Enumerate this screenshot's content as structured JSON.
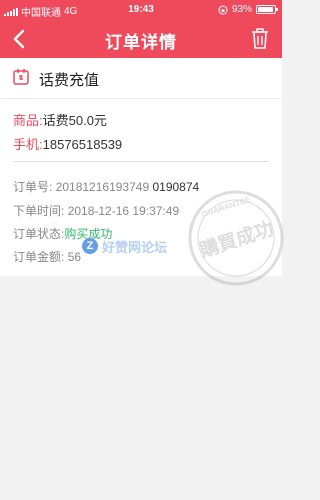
{
  "status": {
    "carrier": "中国联通",
    "network": "4G",
    "time": "19:43",
    "battery": "93%"
  },
  "nav": {
    "title": "订单详情",
    "icons": [
      "back-chevron-icon",
      "trash-icon"
    ]
  },
  "product": {
    "title": "话费充值",
    "icon": "phone-recharge-icon"
  },
  "info": {
    "goods_label": "商品:",
    "goods_value": "话费50.0元",
    "phone_label": "手机:",
    "phone_value": "18576518539"
  },
  "order": {
    "no_label": "订单号:",
    "no_value_a": "20181216193749",
    "no_value_b": "0190874",
    "time_label": "下单时间:",
    "time_value": "2018-12-16 19:37:49",
    "state_label": "订单状态:",
    "state_value": "购买成功",
    "amount_label": "订单金额:",
    "amount_value": "56"
  },
  "watermark": {
    "logo_letter": "Z",
    "logo_text": "好赞网论坛",
    "stamp_text": "購買成功",
    "stamp_ring": "GUARANTEE"
  },
  "colors": {
    "accent": "#ee4a5c",
    "success": "#2fb86f",
    "muted": "#888888"
  }
}
